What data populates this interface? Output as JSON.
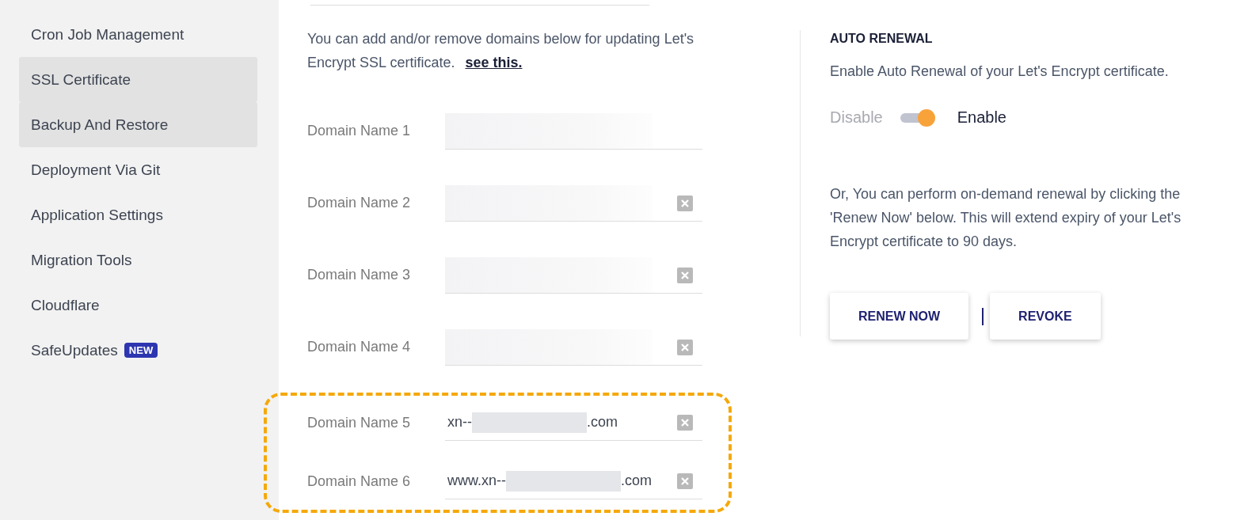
{
  "sidebar": {
    "items": [
      {
        "label": "Cron Job Management",
        "selected": false
      },
      {
        "label": "SSL Certificate",
        "selected": true
      },
      {
        "label": "Backup And Restore",
        "selected": true
      },
      {
        "label": "Deployment Via Git",
        "selected": false
      },
      {
        "label": "Application Settings",
        "selected": false
      },
      {
        "label": "Migration Tools",
        "selected": false
      },
      {
        "label": "Cloudflare",
        "selected": false
      },
      {
        "label": "SafeUpdates",
        "selected": false,
        "badge": "NEW"
      }
    ]
  },
  "domains": {
    "intro": "You can add and/or remove domains below for updating Let's Encrypt SSL certificate.",
    "link": "see this.",
    "fields": [
      {
        "label": "Domain Name 1",
        "kind": "blurred",
        "removable": false
      },
      {
        "label": "Domain Name 2",
        "kind": "blurred",
        "removable": true
      },
      {
        "label": "Domain Name 3",
        "kind": "blurred",
        "removable": true
      },
      {
        "label": "Domain Name 4",
        "kind": "blurred",
        "removable": true
      }
    ],
    "highlighted_fields": [
      {
        "label": "Domain Name 5",
        "kind": "partial",
        "prefix": "xn--",
        "suffix": ".com",
        "removable": true
      },
      {
        "label": "Domain Name 6",
        "kind": "partial",
        "prefix": "www.xn--",
        "suffix": ".com",
        "removable": true
      }
    ]
  },
  "auto_renewal": {
    "title": "AUTO RENEWAL",
    "description": "Enable Auto Renewal of your Let's Encrypt certificate.",
    "off_label": "Disable",
    "on_label": "Enable",
    "on": true,
    "note": "Or, You can perform on-demand renewal by clicking the 'Renew Now' below. This will extend expiry of your Let's Encrypt certificate to 90 days.",
    "buttons": [
      "RENEW NOW",
      "REVOKE"
    ]
  }
}
